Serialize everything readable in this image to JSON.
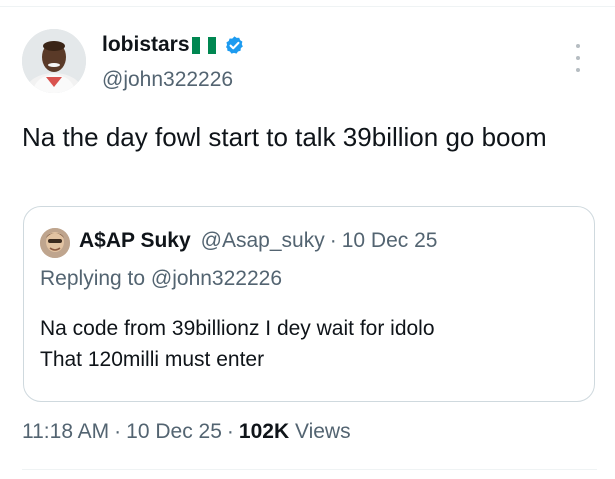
{
  "author": {
    "name": "lobistars",
    "handle": "@john322226",
    "flag_colors": [
      "#008751",
      "#ffffff",
      "#008751"
    ],
    "verified_color": "#1d9bf0"
  },
  "tweet": {
    "text": "Na the day fowl start to talk 39billion go boom"
  },
  "quote": {
    "name": "A$AP Suky",
    "handle": "@Asap_suky",
    "separator": "·",
    "date": "10 Dec 25",
    "replying_label": "Replying to",
    "replying_handle": "@john322226",
    "text_line1": "Na code from 39billionz I dey wait for idolo",
    "text_line2": "That 120milli must enter"
  },
  "meta": {
    "time": "11:18 AM",
    "date": "10 Dec 25",
    "views_count": "102K",
    "views_label": "Views",
    "separator": "·"
  },
  "icons": {
    "verified": "verified-badge-icon",
    "flag": "nigeria-flag-icon",
    "more": "more-options-icon"
  }
}
